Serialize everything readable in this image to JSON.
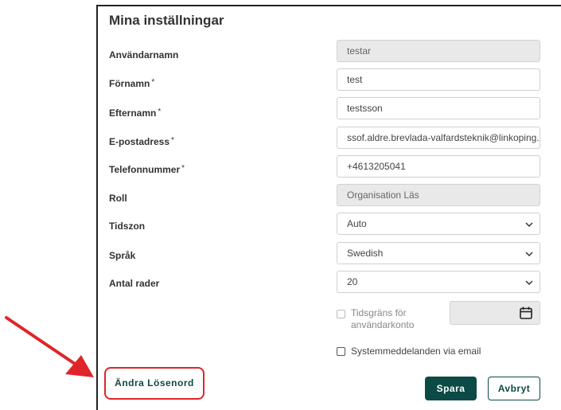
{
  "dialog": {
    "title": "Mina inställningar"
  },
  "fields": [
    {
      "label": "Användarnamn",
      "required": false,
      "value": "testar",
      "readonly": true
    },
    {
      "label": "Förnamn",
      "required": true,
      "value": "test",
      "readonly": false
    },
    {
      "label": "Efternamn",
      "required": true,
      "value": "testsson",
      "readonly": false
    },
    {
      "label": "E-postadress",
      "required": true,
      "value": "ssof.aldre.brevlada-valfardsteknik@linkoping.s",
      "readonly": false
    },
    {
      "label": "Telefonnummer",
      "required": true,
      "value": "+4613205041",
      "readonly": false
    },
    {
      "label": "Roll",
      "required": false,
      "value": "Organisation Läs",
      "readonly": true
    }
  ],
  "selects": [
    {
      "label": "Tidszon",
      "value": "Auto"
    },
    {
      "label": "Språk",
      "value": "Swedish"
    },
    {
      "label": "Antal rader",
      "value": "20"
    }
  ],
  "required_marker": "*",
  "account_time_limit": {
    "label_line1": "Tidsgräns för",
    "label_line2": "användarkonto",
    "checked": false,
    "disabled": true,
    "date_value": ""
  },
  "system_messages": {
    "label": "Systemmeddelanden via email",
    "checked": false
  },
  "buttons": {
    "change_password": "Ändra Lösenord",
    "save": "Spara",
    "cancel": "Avbryt"
  },
  "icons": {
    "arrow": "red-arrow-annotation",
    "calendar": "calendar-icon",
    "chevron": "chevron-down-icon"
  },
  "colors": {
    "primary": "#0c4a45",
    "highlight": "#e0252a",
    "readonly_bg": "#e9e9e9"
  }
}
